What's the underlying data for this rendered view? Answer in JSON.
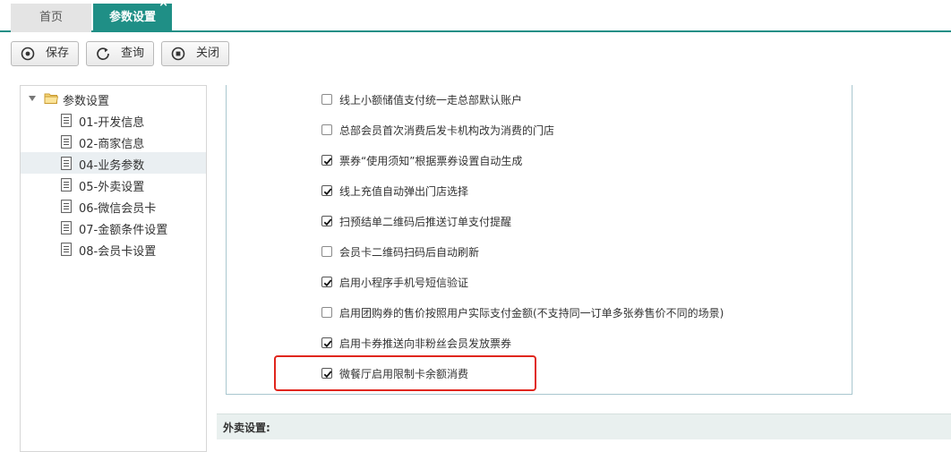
{
  "tabs": [
    {
      "label": "首页"
    },
    {
      "label": "参数设置",
      "close": "×"
    }
  ],
  "toolbar": {
    "save_label": "保存",
    "query_label": "查询",
    "close_label": "关闭"
  },
  "tree": {
    "root_label": "参数设置",
    "items": [
      {
        "label": "01-开发信息"
      },
      {
        "label": "02-商家信息"
      },
      {
        "label": "04-业务参数",
        "selected": true
      },
      {
        "label": "05-外卖设置"
      },
      {
        "label": "06-微信会员卡"
      },
      {
        "label": "07-金额条件设置"
      },
      {
        "label": "08-会员卡设置"
      }
    ]
  },
  "settings": {
    "options": [
      {
        "label": "线上小额储值支付统一走总部默认账户",
        "checked": false
      },
      {
        "label": "总部会员首次消费后发卡机构改为消费的门店",
        "checked": false
      },
      {
        "label": "票券“使用须知”根据票券设置自动生成",
        "checked": true
      },
      {
        "label": "线上充值自动弹出门店选择",
        "checked": true
      },
      {
        "label": "扫预结单二维码后推送订单支付提醒",
        "checked": true
      },
      {
        "label": "会员卡二维码扫码后自动刷新",
        "checked": false
      },
      {
        "label": "启用小程序手机号短信验证",
        "checked": true
      },
      {
        "label": "启用团购券的售价按照用户实际支付金额(不支持同一订单多张券售价不同的场景)",
        "checked": false
      },
      {
        "label": "启用卡券推送向非粉丝会员发放票券",
        "checked": true
      },
      {
        "label": "微餐厅启用限制卡余额消费",
        "checked": true
      }
    ],
    "highlight_color": "#e0261d"
  },
  "section": {
    "title": "外卖设置:"
  },
  "colors": {
    "accent": "#1f8f86",
    "panel_border": "#a9c7cf"
  }
}
